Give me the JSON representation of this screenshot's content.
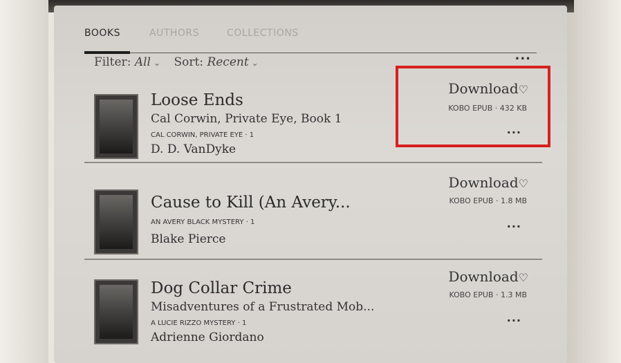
{
  "tabs": [
    {
      "label": "BOOKS",
      "active": true
    },
    {
      "label": "AUTHORS",
      "active": false
    },
    {
      "label": "COLLECTIONS",
      "active": false
    }
  ],
  "filter": {
    "label": "Filter:",
    "value": "All"
  },
  "sort": {
    "label": "Sort:",
    "value": "Recent"
  },
  "more_label": "...",
  "download_icon": "download-arrow-icon",
  "highlight_color": "#d62020",
  "books": [
    {
      "title": "Loose Ends",
      "subtitle": "Cal Corwin, Private Eye, Book 1",
      "series": "CAL CORWIN, PRIVATE EYE · 1",
      "author": "D. D. VanDyke",
      "download_label": "Download",
      "format": "KOBO EPUB · 432 KB"
    },
    {
      "title": "Cause to Kill (An Avery...",
      "subtitle": "",
      "series": "AN AVERY BLACK MYSTERY · 1",
      "author": "Blake Pierce",
      "download_label": "Download",
      "format": "KOBO EPUB · 1.8 MB"
    },
    {
      "title": "Dog Collar Crime",
      "subtitle": "Misadventures of a Frustrated Mob...",
      "series": "A LUCIE RIZZO MYSTERY · 1",
      "author": "Adrienne Giordano",
      "download_label": "Download",
      "format": "KOBO EPUB · 1.3 MB"
    }
  ]
}
